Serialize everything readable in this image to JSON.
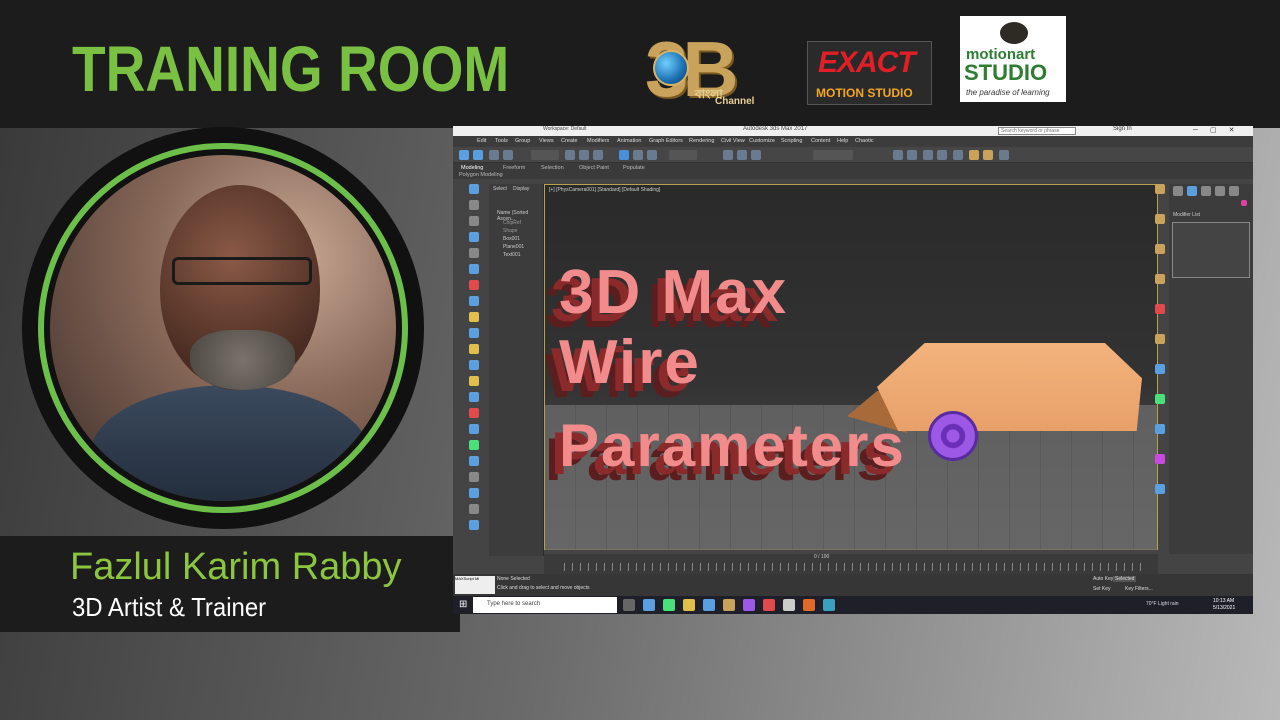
{
  "page": {
    "title": "TRANING ROOM"
  },
  "logos": {
    "channel_3b": {
      "numeral": "3B",
      "bengali": "বাংলা",
      "label": "Channel"
    },
    "exact": {
      "name": "EXACT",
      "sub": "MOTION STUDIO"
    },
    "motionart": {
      "top": "motionart",
      "main": "STUDIO",
      "tagline": "the paradise of learning"
    }
  },
  "presenter": {
    "name": "Fazlul Karim Rabby",
    "role": "3D Artist & Trainer"
  },
  "app": {
    "title": "Autodesk 3ds Max 2017",
    "workspace": "Workspace: Default",
    "search_placeholder": "Search keyword or phrase",
    "sign_in": "Sign In",
    "menu": [
      "Edit",
      "Tools",
      "Group",
      "Views",
      "Create",
      "Modifiers",
      "Animation",
      "Graph Editors",
      "Rendering",
      "Civil View",
      "Customize",
      "Scripting",
      "Content",
      "Help",
      "Chaotic"
    ],
    "ribbon_tabs": [
      "Modeling",
      "Freeform",
      "Selection",
      "Object Paint",
      "Populate"
    ],
    "ribbon_sub": "Polygon Modeling",
    "scene_tabs": {
      "select": "Select",
      "display": "Display"
    },
    "scene_items": [
      "Name (Sorted Ascen...",
      "ChipRef",
      "Shape",
      "Box001",
      "Plane001",
      "Text001"
    ],
    "viewport_label": "[+] [PhysCamera001] [Standard] [Default Shading]",
    "modifier_list": "Modifier List",
    "timeline": {
      "frame": "0 / 100"
    },
    "status": {
      "selected": "None Selected",
      "hint": "Click and drag to select and move objects",
      "auto_key": "Auto Key",
      "selected_label": "Selected",
      "set_key": "Set Key",
      "key_filters": "Key Filters...",
      "maxscript": "MAXScript Mi"
    },
    "taskbar": {
      "search": "Type here to search",
      "weather": "70°F  Light rain",
      "time": "10:13 AM",
      "date": "5/13/2021"
    }
  },
  "viewport_text": [
    "3D Max",
    "Wire",
    "Parameters"
  ],
  "colors": {
    "title_green": "#7ac143",
    "name_green": "#8cc63f",
    "text_pink": "#f28b8b",
    "car": "#f3b37c",
    "wheel": "#9b59e6"
  }
}
